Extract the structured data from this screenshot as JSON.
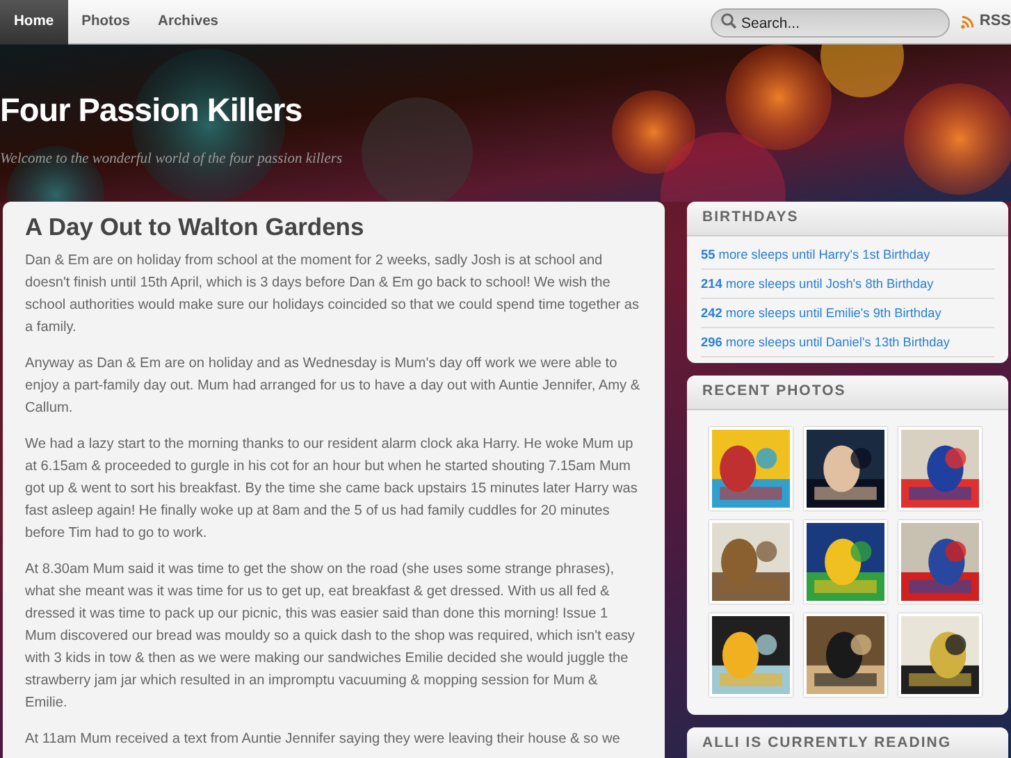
{
  "nav": {
    "items": [
      {
        "label": "Home",
        "selected": true
      },
      {
        "label": "Photos",
        "selected": false
      },
      {
        "label": "Archives",
        "selected": false
      }
    ]
  },
  "search": {
    "placeholder": "Search..."
  },
  "rss": {
    "label": "RSS"
  },
  "header": {
    "title": "Four Passion Killers",
    "tagline": "Welcome to the wonderful world of the four passion killers"
  },
  "post": {
    "title": "A Day Out to Walton Gardens",
    "paragraphs": [
      "Dan & Em are on holiday from school at the moment for 2 weeks, sadly Josh is at school and doesn't finish until 15th April, which is 3 days before Dan & Em go back to school!  We wish the school authorities would make sure our holidays coincided so that we could spend time together as a family.",
      "Anyway as Dan & Em are on holiday and as Wednesday is Mum's day off work we were able to enjoy a part-family day out.  Mum had arranged for us to have a day out with Auntie Jennifer, Amy & Callum.",
      "We had a lazy start to the morning thanks to our resident alarm clock aka Harry.  He woke Mum up at 6.15am & proceeded to gurgle in his cot for an hour but when he started shouting 7.15am Mum got up & went to sort his breakfast.  By the time she came back upstairs 15 minutes later Harry was fast asleep again!  He finally woke up at 8am and the 5 of us had family cuddles for 20 minutes before Tim had to go to work.",
      "At 8.30am Mum said it was time to get the show on the road (she uses some strange phrases), what she meant was it was time for us to get up, eat breakfast & get dressed.  With us all fed & dressed it was time to pack up our picnic, this was easier said than done this morning!  Issue 1 Mum discovered our bread was mouldy so a quick dash to the shop was required, which isn't easy with 3 kids in tow & then as we were making our sandwiches Emilie decided she would juggle the strawberry jam jar which resulted in an impromptu vacuuming & mopping session for Mum & Emilie.",
      "At 11am Mum received a text from Auntie Jennifer saying they were leaving their house & so we"
    ]
  },
  "sidebar": {
    "widgets": [
      {
        "kind": "links",
        "title": "BIRTHDAYS",
        "items": [
          "**55** more sleeps until Harry's 1st Birthday",
          "**214** more sleeps until Josh's 8th Birthday",
          "**242** more sleeps until Emilie's 9th Birthday",
          "**296** more sleeps until Daniel's 13th Birthday"
        ]
      },
      {
        "kind": "photos",
        "title": "RECENT PHOTOS"
      },
      {
        "kind": "links",
        "title": "ALLI IS CURRENTLY READING"
      }
    ]
  }
}
